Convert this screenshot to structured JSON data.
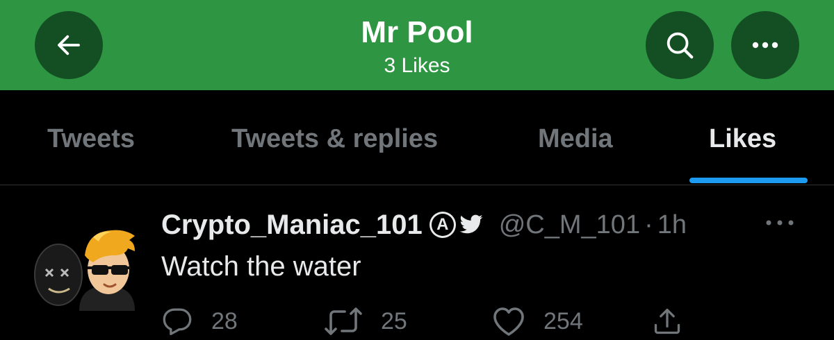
{
  "header": {
    "title": "Mr Pool",
    "subtitle": "3 Likes",
    "back_icon": "arrow-left-icon",
    "search_icon": "search-icon",
    "more_icon": "more-horizontal-icon",
    "background": "#2e9642",
    "button_color": "#134f23"
  },
  "tabs": [
    {
      "label": "Tweets",
      "active": false
    },
    {
      "label": "Tweets & replies",
      "active": false
    },
    {
      "label": "Media",
      "active": false
    },
    {
      "label": "Likes",
      "active": true
    }
  ],
  "accent": "#1d9bf0",
  "tweet": {
    "display_name": "Crypto_Maniac_101",
    "badge_letter": "A",
    "handle": "@C_M_101",
    "separator": "·",
    "time": "1h",
    "text": "Watch the water",
    "replies": "28",
    "retweets": "25",
    "likes": "254",
    "icons": [
      "reply-icon",
      "retweet-icon",
      "heart-icon",
      "share-icon"
    ]
  }
}
